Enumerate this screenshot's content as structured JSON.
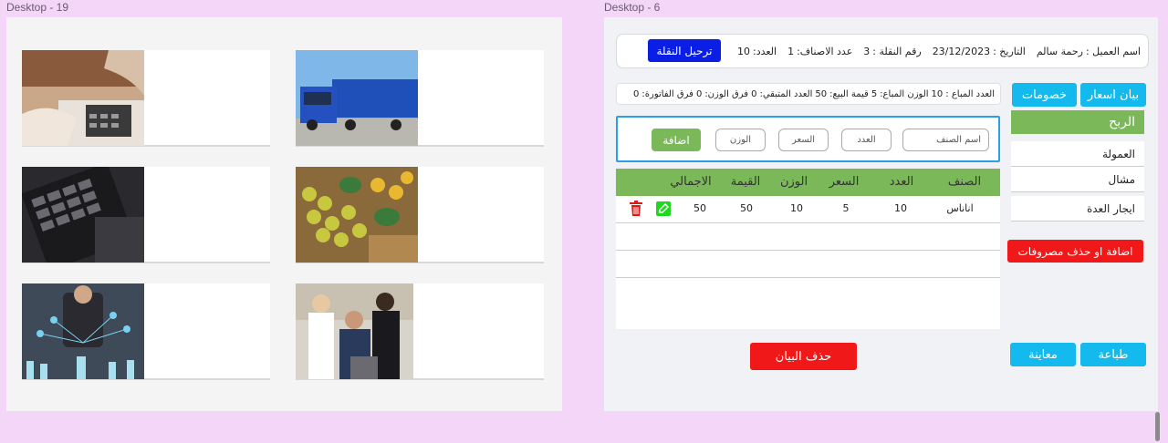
{
  "frames": {
    "left_title": "Desktop - 19",
    "right_title": "Desktop - 6"
  },
  "left_cards": [
    {
      "image": "finance-calculator-photo"
    },
    {
      "image": "blue-truck-photo"
    },
    {
      "image": "calculator-keypad-photo"
    },
    {
      "image": "fruit-crates-photo"
    },
    {
      "image": "business-network-photo"
    },
    {
      "image": "office-team-photo"
    }
  ],
  "info": {
    "customer_label": "اسم العميل :",
    "customer_value": "رحمة سالم",
    "date_label": "التاريخ :",
    "date_value": "23/12/2023",
    "shipment_label": "رقم النقلة :",
    "shipment_value": "3",
    "items_label": "عدد الاصناف:",
    "items_value": "1",
    "count_label": "العدد:",
    "count_value": "10",
    "transfer_button": "ترحيل النقلة"
  },
  "totals": {
    "sold_count_label": "العدد المباع :",
    "sold_count": "10",
    "sold_weight_label": "الوزن المباع:",
    "sold_weight": "5",
    "sale_value_label": "قيمة البيع:",
    "sale_value": "50",
    "remaining_label": "العدد المتبقي:",
    "remaining": "0",
    "weight_diff_label": "فرق الوزن:",
    "weight_diff": "0",
    "invoice_diff_label": "فرق الفاتورة:",
    "invoice_diff": "0"
  },
  "add_form": {
    "item_name": "اسم الصنف",
    "count": "العدد",
    "price": "السعر",
    "weight": "الوزن",
    "add_button": "اضافة"
  },
  "table": {
    "headers": [
      "الصنف",
      "العدد",
      "السعر",
      "الوزن",
      "القيمة",
      "الاجمالي"
    ],
    "rows": [
      {
        "item": "اناناس",
        "count": "10",
        "price": "5",
        "weight": "10",
        "value": "50",
        "total": "50"
      }
    ]
  },
  "side": {
    "price_statement": "بيان اسعار",
    "discounts": "خصومات",
    "profit": "الربح",
    "commission": "العمولة",
    "porter": "مشال",
    "equipment_rent": "ايجار العدة",
    "add_delete_expenses": "اضافة او حذف مصروفات"
  },
  "bottom": {
    "print": "طباعة",
    "preview": "معاينة",
    "delete_statement": "حذف البيان"
  },
  "colors": {
    "blue_button": "#0a1ee6",
    "cyan_button": "#14b9ee",
    "green": "#7bb85a",
    "red": "#f01818"
  }
}
